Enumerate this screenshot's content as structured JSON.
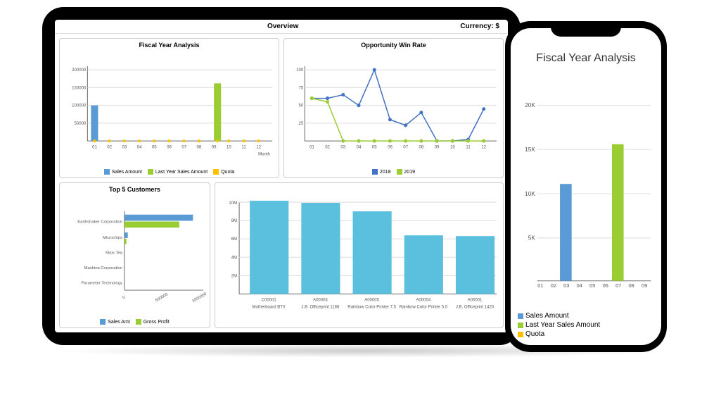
{
  "tablet": {
    "header_title": "Overview",
    "header_currency": "Currency: $"
  },
  "colors": {
    "sales": "#5B9BD5",
    "lastyear": "#9ACD32",
    "quota": "#FFC000",
    "line2018": "#4472C4",
    "line2019": "#9ACD32",
    "productbar": "#5BC0DE"
  },
  "chart_data": [
    {
      "id": "fiscal_year",
      "type": "bar",
      "title": "Fiscal Year Analysis",
      "categories": [
        "01",
        "02",
        "03",
        "04",
        "05",
        "06",
        "07",
        "08",
        "09",
        "10",
        "11",
        "12"
      ],
      "series": [
        {
          "name": "Sales Amount",
          "values": [
            100000,
            0,
            0,
            0,
            0,
            0,
            0,
            0,
            0,
            0,
            0,
            0
          ]
        },
        {
          "name": "Last Year Sales Amount",
          "values": [
            0,
            0,
            0,
            0,
            0,
            0,
            0,
            0,
            163000,
            0,
            0,
            0
          ]
        },
        {
          "name": "Quota",
          "values": [
            0,
            0,
            0,
            0,
            0,
            0,
            0,
            0,
            0,
            0,
            0,
            0
          ]
        }
      ],
      "ylim": [
        0,
        200000
      ],
      "yticks": [
        50000,
        100000,
        150000,
        200000
      ],
      "xlabel": "Month"
    },
    {
      "id": "opportunity",
      "type": "line",
      "title": "Opportunity Win Rate",
      "categories": [
        "01",
        "02",
        "03",
        "04",
        "05",
        "06",
        "07",
        "08",
        "09",
        "10",
        "11",
        "12"
      ],
      "series": [
        {
          "name": "2018",
          "values": [
            60,
            60,
            65,
            50,
            100,
            30,
            22,
            40,
            0,
            0,
            2,
            45
          ]
        },
        {
          "name": "2019",
          "values": [
            60,
            55,
            0,
            0,
            0,
            0,
            0,
            0,
            0,
            0,
            0,
            0
          ]
        }
      ],
      "ylim": [
        0,
        100
      ],
      "yticks": [
        25,
        50,
        75,
        100
      ]
    },
    {
      "id": "top5",
      "type": "bar_horizontal",
      "title": "Top 5 Customers",
      "categories": [
        "Earthshaker Corporation",
        "Microchips",
        "Maxi-Teq",
        "Mashina Corporation",
        "Parameter Technology"
      ],
      "series": [
        {
          "name": "Sales Amt",
          "values": [
            90000,
            3000,
            0,
            0,
            0
          ]
        },
        {
          "name": "Gross Profit",
          "values": [
            70000,
            2000,
            0,
            0,
            0
          ]
        }
      ],
      "xlim": [
        0,
        100000
      ],
      "xticks": [
        0,
        50000,
        100000
      ],
      "xtick_labels": [
        "0",
        "500000",
        "1000000"
      ]
    },
    {
      "id": "products",
      "type": "bar",
      "title": "",
      "categories_top": [
        "C00001",
        "A00003",
        "A00005",
        "A00004",
        "A00001"
      ],
      "categories_bottom": [
        "Motherboard BTX",
        "J.B. Officeprint 1186",
        "Rainbow Color Printer 7.5",
        "Rainbow Color Printer 5.0",
        "J.B. Officeprint 1420"
      ],
      "values": [
        10200000,
        9900000,
        9000000,
        6400000,
        6300000
      ],
      "ylim": [
        0,
        10000000
      ],
      "yticks": [
        2000000,
        4000000,
        6000000,
        8000000,
        10000000
      ],
      "ytick_labels": [
        "2M",
        "4M",
        "6M",
        "8M",
        "10M"
      ]
    },
    {
      "id": "phone_fiscal",
      "type": "bar",
      "title": "Fiscal Year Analysis",
      "categories": [
        "01",
        "02",
        "03",
        "04",
        "05",
        "06",
        "07",
        "08",
        "09"
      ],
      "series": [
        {
          "name": "Sales Amount",
          "values": [
            0,
            0,
            11000,
            0,
            0,
            0,
            0,
            0,
            0
          ]
        },
        {
          "name": "Last Year Sales Amount",
          "values": [
            0,
            0,
            0,
            0,
            0,
            0,
            15500,
            0,
            0
          ]
        },
        {
          "name": "Quota",
          "values": [
            0,
            0,
            0,
            0,
            0,
            0,
            0,
            0,
            0
          ]
        }
      ],
      "ylim": [
        0,
        20000
      ],
      "yticks": [
        5000,
        10000,
        15000,
        20000
      ],
      "ytick_labels": [
        "5K",
        "10K",
        "15K",
        "20K"
      ]
    }
  ]
}
